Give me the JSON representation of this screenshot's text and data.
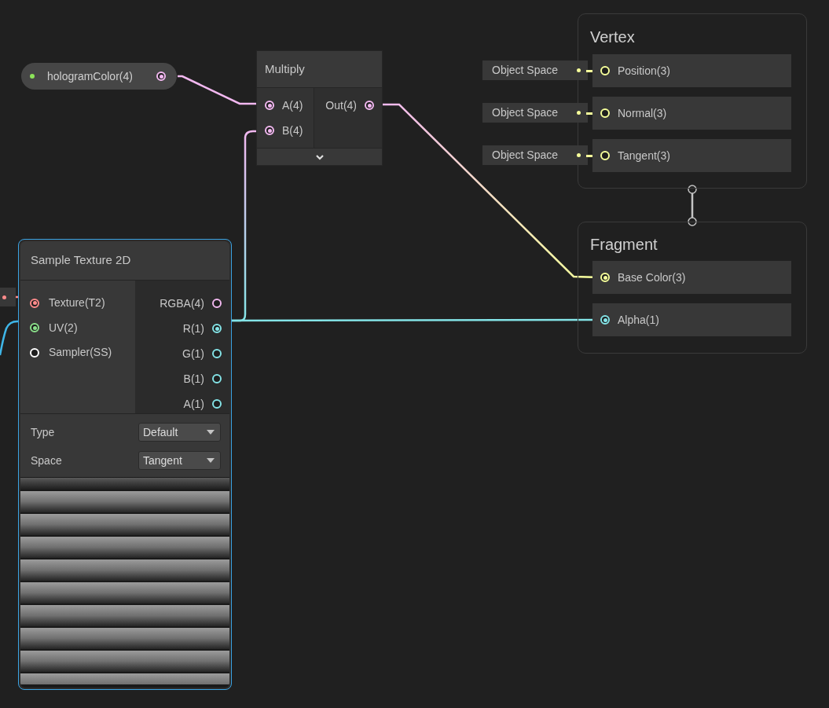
{
  "property_node": {
    "label": "hologramColor(4)"
  },
  "multiply_node": {
    "title": "Multiply",
    "inputs": [
      {
        "label": "A(4)",
        "connected": true
      },
      {
        "label": "B(4)",
        "connected": true
      }
    ],
    "outputs": [
      {
        "label": "Out(4)",
        "connected": true
      }
    ]
  },
  "vertex_block": {
    "title": "Vertex",
    "slots": [
      {
        "label": "Position(3)",
        "default": "Object Space"
      },
      {
        "label": "Normal(3)",
        "default": "Object Space"
      },
      {
        "label": "Tangent(3)",
        "default": "Object Space"
      }
    ]
  },
  "fragment_block": {
    "title": "Fragment",
    "slots": [
      {
        "label": "Base Color(3)",
        "color": "#f6ff9a"
      },
      {
        "label": "Alpha(1)",
        "color": "#84e4e7"
      }
    ]
  },
  "sample_texture_node": {
    "title": "Sample Texture 2D",
    "selected": true,
    "inputs": [
      {
        "label": "Texture(T2)",
        "color": "#ff8b8b",
        "connected": true
      },
      {
        "label": "UV(2)",
        "color": "#8be08b",
        "connected": true
      },
      {
        "label": "Sampler(SS)",
        "color": "#ffffff",
        "connected": false
      }
    ],
    "outputs": [
      {
        "label": "RGBA(4)",
        "color": "#f2b8f0",
        "connected": false
      },
      {
        "label": "R(1)",
        "color": "#84e4e7",
        "connected": true
      },
      {
        "label": "G(1)",
        "color": "#84e4e7",
        "connected": false
      },
      {
        "label": "B(1)",
        "color": "#84e4e7",
        "connected": false
      },
      {
        "label": "A(1)",
        "color": "#84e4e7",
        "connected": false
      }
    ],
    "settings": [
      {
        "label": "Type",
        "value": "Default"
      },
      {
        "label": "Space",
        "value": "Tangent"
      }
    ]
  }
}
